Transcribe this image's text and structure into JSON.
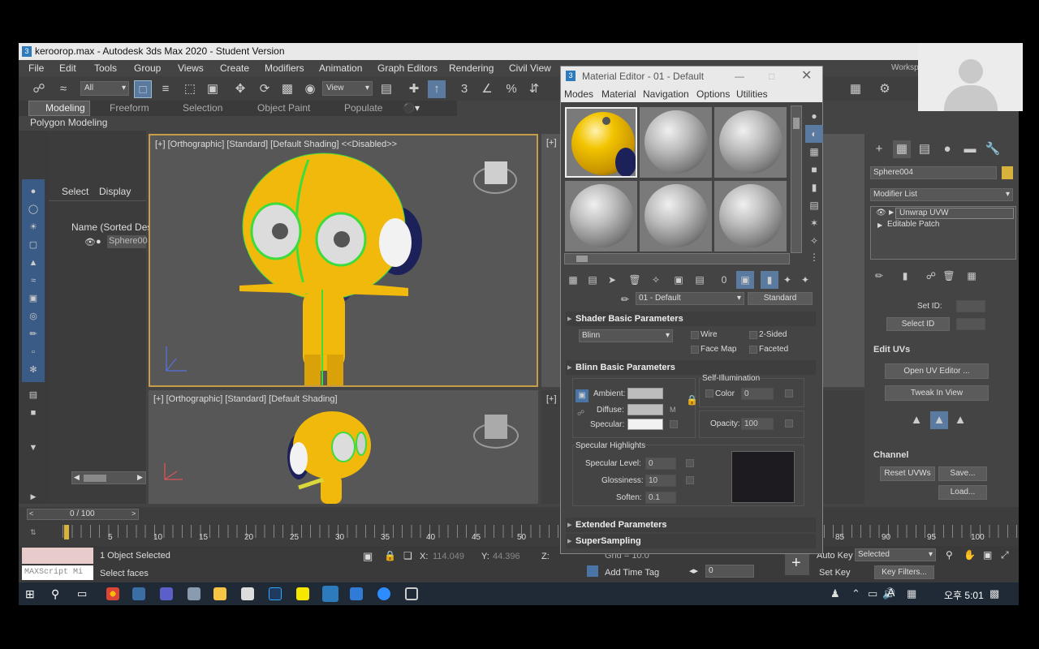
{
  "window": {
    "title": "keroorор.max - Autodesk 3ds Max 2020 - Student Version"
  },
  "menu": [
    "File",
    "Edit",
    "Tools",
    "Group",
    "Views",
    "Create",
    "Modifiers",
    "Animation",
    "Graph Editors",
    "Rendering",
    "Civil View"
  ],
  "workspaces_label": "Workspaces:",
  "toolbar": {
    "filter": "All",
    "view": "View"
  },
  "ribbon": {
    "tabs": [
      "Modeling",
      "Freeform",
      "Selection",
      "Object Paint",
      "Populate"
    ],
    "sub": "Polygon Modeling"
  },
  "scene_explorer": {
    "tabs": [
      "Select",
      "Display"
    ],
    "column": "Name (Sorted Des",
    "item": "Sphere00"
  },
  "viewports": {
    "top_left": "[+] [Orthographic] [Standard] [Default Shading]  <<Disabled>>",
    "bottom_left": "[+] [Orthographic] [Standard] [Default Shading]",
    "top_right": "[+]",
    "bottom_right": "[+]"
  },
  "material_editor": {
    "title": "Material Editor - 01 - Default",
    "menu": [
      "Modes",
      "Material",
      "Navigation",
      "Options",
      "Utilities"
    ],
    "material_name": "01 - Default",
    "material_type": "Standard",
    "rollouts": {
      "shader_basic": "Shader Basic Parameters",
      "blinn_basic": "Blinn Basic Parameters",
      "extended": "Extended Parameters",
      "supersampling": "SuperSampling"
    },
    "shader": "Blinn",
    "options": [
      "Wire",
      "2-Sided",
      "Face Map",
      "Faceted"
    ],
    "ambient": "Ambient:",
    "diffuse": "Diffuse:",
    "specular": "Specular:",
    "map_m": "M",
    "self_illum": "Self-Illumination",
    "color_label": "Color",
    "color_value": "0",
    "opacity_label": "Opacity:",
    "opacity_value": "100",
    "spec_highlights": "Specular Highlights",
    "spec_level_label": "Specular Level:",
    "spec_level": "0",
    "glossiness_label": "Glossiness:",
    "glossiness": "10",
    "soften_label": "Soften:",
    "soften": "0.1"
  },
  "command_panel": {
    "object_name": "Sphere004",
    "modifier_list": "Modifier List",
    "stack": [
      "Unwrap UVW",
      "Editable Patch"
    ],
    "set_id": "Set ID:",
    "select_id": "Select ID",
    "edit_uvs": "Edit UVs",
    "open_uv_editor": "Open UV Editor ...",
    "tweak_in_view": "Tweak In View",
    "channel": "Channel",
    "reset_uvws": "Reset UVWs",
    "save": "Save...",
    "load": "Load..."
  },
  "timeline": {
    "counter": "0 / 100",
    "ticks": [
      "5",
      "10",
      "15",
      "20",
      "25",
      "30",
      "35",
      "40",
      "45",
      "50",
      "85",
      "90",
      "95",
      "100"
    ]
  },
  "status": {
    "maxscript": "MAXScript Mi",
    "selected": "1 Object Selected",
    "prompt": "Select faces",
    "x_label": "X:",
    "x": "114.049",
    "y_label": "Y:",
    "y": "44.396",
    "z_label": "Z:",
    "grid": "Grid = 10.0",
    "add_time_tag": "Add Time Tag",
    "frame": "0",
    "auto_key": "Auto Key",
    "selected_dd": "Selected",
    "set_key": "Set Key",
    "key_filters": "Key Filters..."
  },
  "taskbar": {
    "time": "오후 5:01",
    "lang": "A"
  }
}
